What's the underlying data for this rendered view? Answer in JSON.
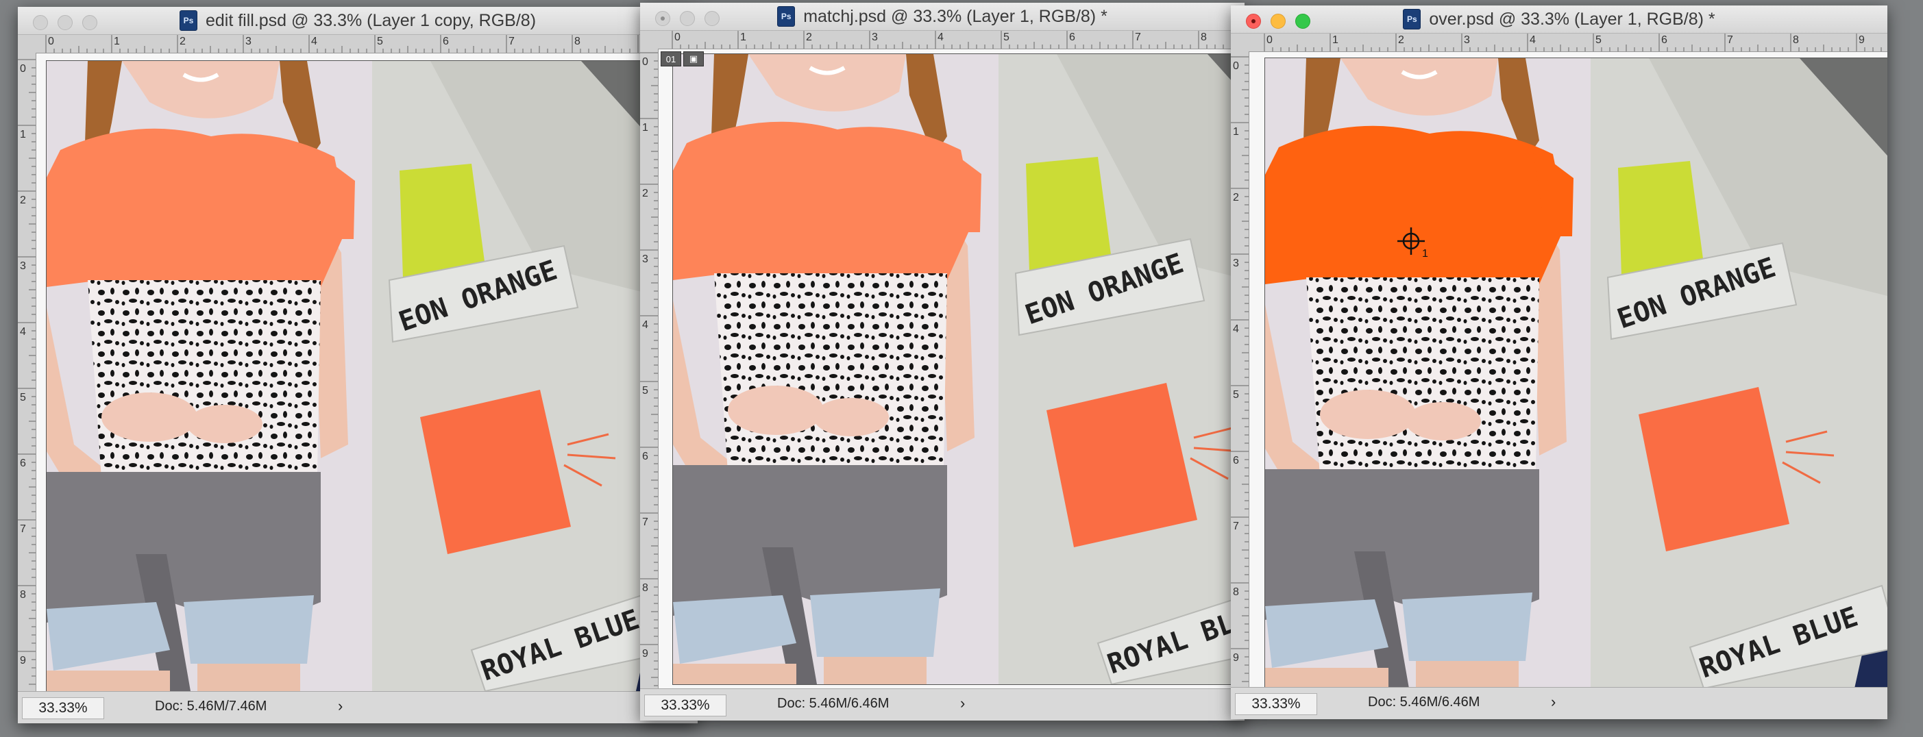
{
  "windows": [
    {
      "id": "edit-fill",
      "title": "edit fill.psd @ 33.3% (Layer 1 copy, RGB/8)",
      "zoom": "33.33%",
      "doc": "Doc: 5.46M/7.46M",
      "active": false,
      "top_color": "#fe8458"
    },
    {
      "id": "matchj",
      "title": "matchj.psd @ 33.3% (Layer 1, RGB/8) *",
      "zoom": "33.33%",
      "doc": "Doc: 5.46M/6.46M",
      "active": false,
      "top_color": "#fe8458"
    },
    {
      "id": "over",
      "title": "over.psd @ 33.3% (Layer 1, RGB/8) *",
      "zoom": "33.33%",
      "doc": "Doc: 5.46M/6.46M",
      "active": true,
      "top_color": "#ff6210"
    }
  ],
  "ruler_labels": [
    "0",
    "1",
    "2",
    "3",
    "4",
    "5",
    "6",
    "7",
    "8",
    "9"
  ],
  "photo": {
    "swatch_label_1": "EON ORANGE",
    "swatch_label_2": "ROYAL BLUE",
    "swatch_label_2_clipped": "ROYAL BL"
  },
  "layer_chip": {
    "num": "01",
    "icon": "image-icon"
  },
  "cursor_marker": "1",
  "colors": {
    "desktop": "#7f8284",
    "close": "#fc605c",
    "minimize": "#fdbc40",
    "maximize": "#34c84a",
    "neon_orange_swatch": "#fa6d44",
    "lime_swatch": "#cbdc36"
  }
}
